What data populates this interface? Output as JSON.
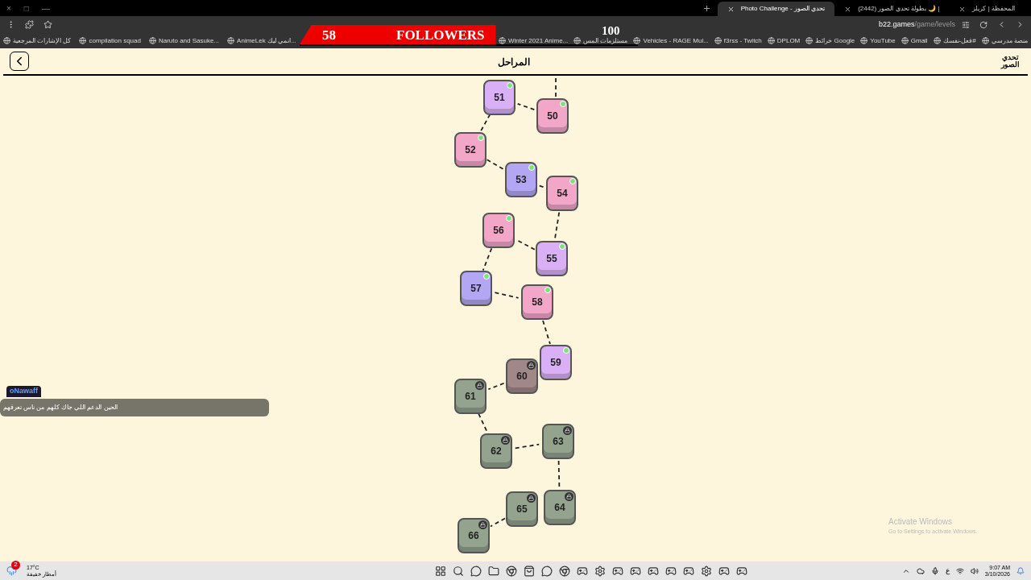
{
  "window_controls": [
    "—",
    "□",
    "×"
  ],
  "tabs": [
    {
      "title": "المحفظة | كريلز",
      "selected": false
    },
    {
      "title": "(2442) بطولة تحدي الصور 🌙 |",
      "selected": false
    },
    {
      "title": "Photo Challenge - تحدي الصور",
      "selected": true
    }
  ],
  "address_bar": {
    "host": "b22.games",
    "path": "/game/levels"
  },
  "bookmarks_right": [
    "منصة مدرسي",
    "فعل-نفسك#",
    "Gmail",
    "YouTube",
    "خرائط Google",
    "DPLOM",
    "f3rss - Twitch",
    "Vehicles - RAGE Mul...",
    "مستلزمات المس",
    "Winter 2021 Anime..."
  ],
  "bookmarks_left": [
    "AnimeLek انمي ليك...",
    "Naruto and Sasuke...",
    "compilation squad",
    "كل الإشارات المرجعية"
  ],
  "followers_overlay": {
    "current": "58",
    "label": "FOLLOWERS",
    "goal": "100",
    "level": 0.58
  },
  "header": {
    "title": "المراحل",
    "logo": "تحدي الصور"
  },
  "levels": [
    {
      "number": "50",
      "color": "#f2a7c8",
      "locked": false
    },
    {
      "number": "51",
      "color": "#d9b0f5",
      "locked": false
    },
    {
      "number": "52",
      "color": "#f2a7c8",
      "locked": false
    },
    {
      "number": "53",
      "color": "#b3a6f2",
      "locked": false
    },
    {
      "number": "54",
      "color": "#f2a7c8",
      "locked": false
    },
    {
      "number": "55",
      "color": "#d9b0f5",
      "locked": false
    },
    {
      "number": "56",
      "color": "#f2a7c8",
      "locked": false
    },
    {
      "number": "57",
      "color": "#b3a6f2",
      "locked": false
    },
    {
      "number": "58",
      "color": "#f2a7c8",
      "locked": false
    },
    {
      "number": "59",
      "color": "#d9b0f5",
      "locked": false
    },
    {
      "number": "60",
      "color": "#a08888",
      "locked": true
    },
    {
      "number": "61",
      "color": "#93a38e",
      "locked": true
    },
    {
      "number": "62",
      "color": "#93a38e",
      "locked": true
    },
    {
      "number": "63",
      "color": "#93a38e",
      "locked": true
    },
    {
      "number": "64",
      "color": "#93a38e",
      "locked": true
    },
    {
      "number": "65",
      "color": "#93a38e",
      "locked": true
    },
    {
      "number": "66",
      "color": "#93a38e",
      "locked": true
    }
  ],
  "chat": {
    "user": "oNawaff",
    "message": "الحين الدعم اللي جاك كلهم من ناس تعرفهم"
  },
  "activation_notice": {
    "title": "Activate Windows",
    "hint": "Go to Settings to activate Windows."
  },
  "taskbar": {
    "weather_temp": "17°C",
    "weather_text": "أمطار خفيفة",
    "weather_badge": "2",
    "language": "ع",
    "time": "9:07 AM",
    "date": "3/10/2026"
  }
}
